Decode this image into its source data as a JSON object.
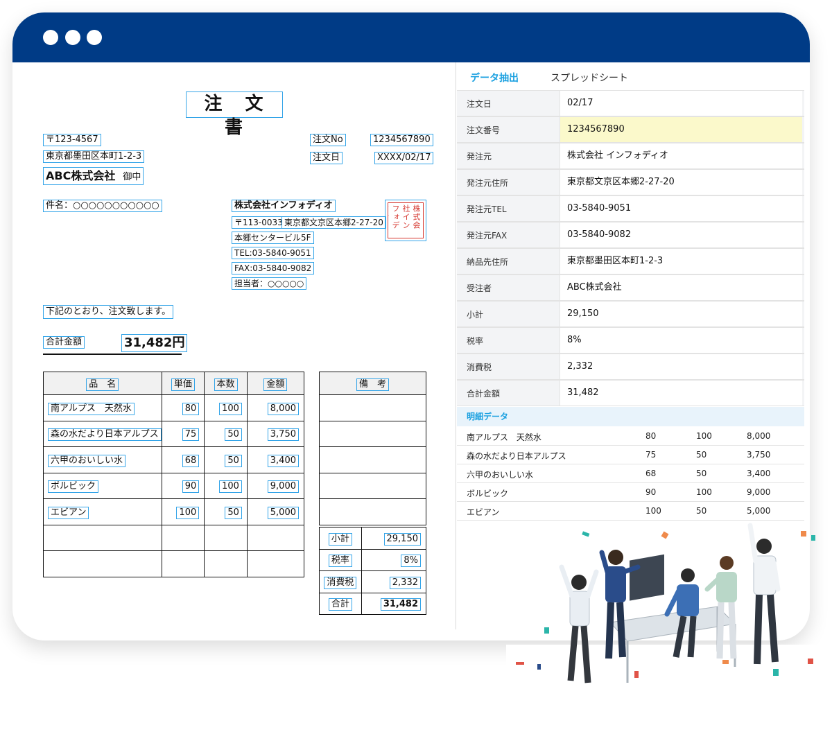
{
  "order": {
    "title": "注 文 書",
    "postal_to": "〒123-4567",
    "address_to": "東京都墨田区本町1-2-3",
    "company_to": "ABC株式会社",
    "honorific": "御中",
    "order_no_label": "注文No",
    "order_no": "1234567890",
    "order_date_label": "注文日",
    "order_date": "XXXX/02/17",
    "subject": "件名：○○○○○○○○○○○",
    "issuer_name": "株式会社インフォディオ",
    "issuer_postal": "〒113-0033",
    "issuer_address": "東京都文京区本郷2-27-20",
    "issuer_building": "本郷センタービル5F",
    "issuer_tel": "TEL:03-5840-9051",
    "issuer_fax": "FAX:03-5840-9082",
    "issuer_person": "担当者：○○○○○",
    "stamp_text": "株式会社インフォディオ",
    "message": "下記のとおり、注文致します。",
    "total_label": "合計金額",
    "total_value": "31,482円",
    "table_headers": [
      "品　名",
      "単価",
      "本数",
      "金額"
    ],
    "notes_header": "備　考",
    "items": [
      {
        "name": "南アルプス　天然水",
        "price": "80",
        "qty": "100",
        "amount": "8,000"
      },
      {
        "name": "森の水だより日本アルプス",
        "price": "75",
        "qty": "50",
        "amount": "3,750"
      },
      {
        "name": "六甲のおいしい水",
        "price": "68",
        "qty": "50",
        "amount": "3,400"
      },
      {
        "name": "ボルビック",
        "price": "90",
        "qty": "100",
        "amount": "9,000"
      },
      {
        "name": "エビアン",
        "price": "100",
        "qty": "50",
        "amount": "5,000"
      }
    ],
    "summary": [
      {
        "label": "小計",
        "value": "29,150"
      },
      {
        "label": "税率",
        "value": "8%"
      },
      {
        "label": "消費税",
        "value": "2,332"
      },
      {
        "label": "合計",
        "value": "31,482"
      }
    ]
  },
  "panel": {
    "tab_active": "データ抽出",
    "tab_inactive": "スプレッドシート",
    "fields": [
      {
        "label": "注文日",
        "value": "02/17"
      },
      {
        "label": "注文番号",
        "value": "1234567890",
        "highlight": true
      },
      {
        "label": "発注元",
        "value": "株式会社 インフォディオ"
      },
      {
        "label": "発注元住所",
        "value": "東京都文京区本郷2-27-20"
      },
      {
        "label": "発注元TEL",
        "value": "03-5840-9051"
      },
      {
        "label": "発注元FAX",
        "value": "03-5840-9082"
      },
      {
        "label": "納品先住所",
        "value": "東京都墨田区本町1-2-3"
      },
      {
        "label": "受注者",
        "value": "ABC株式会社"
      },
      {
        "label": "小計",
        "value": "29,150"
      },
      {
        "label": "税率",
        "value": "8%"
      },
      {
        "label": "消費税",
        "value": "2,332"
      },
      {
        "label": "合計金額",
        "value": "31,482"
      }
    ],
    "detail_header": "明細データ",
    "details": [
      {
        "name": "南アルプス　天然水",
        "price": "80",
        "qty": "100",
        "amount": "8,000"
      },
      {
        "name": "森の水だより日本アルプス",
        "price": "75",
        "qty": "50",
        "amount": "3,750"
      },
      {
        "name": "六甲のおいしい水",
        "price": "68",
        "qty": "50",
        "amount": "3,400"
      },
      {
        "name": "ボルビック",
        "price": "90",
        "qty": "100",
        "amount": "9,000"
      },
      {
        "name": "エビアン",
        "price": "100",
        "qty": "50",
        "amount": "5,000"
      }
    ]
  },
  "colors": {
    "titlebar": "#003b86",
    "ocr_box": "#33a4e8",
    "stamp": "#d5362e",
    "tab_active": "#1aa0e0",
    "highlight": "#fbf9cb"
  }
}
